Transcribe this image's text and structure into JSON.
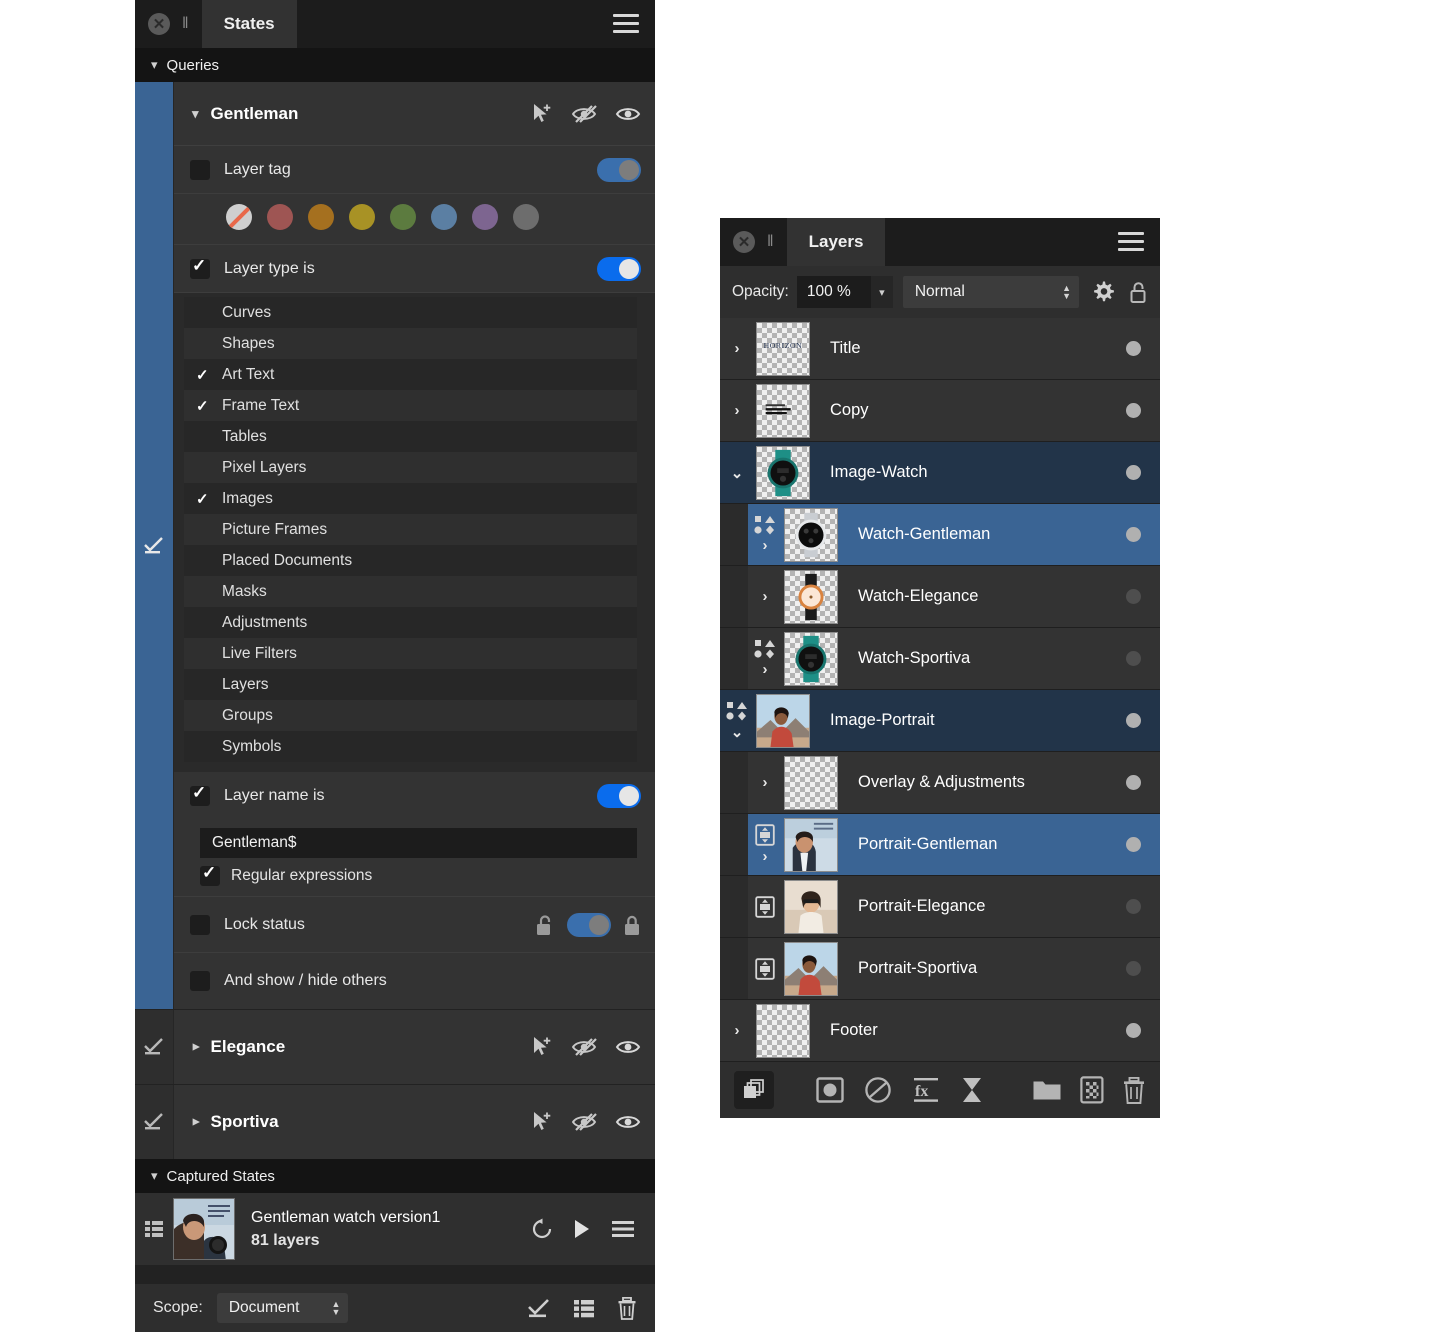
{
  "states_panel": {
    "title": "States",
    "sections": {
      "queries_label": "Queries",
      "captured_label": "Captured States"
    },
    "queries": [
      {
        "name": "Gentleman",
        "expanded": true,
        "conditions": {
          "layer_tag": {
            "label": "Layer tag",
            "checked": false,
            "toggle": "off"
          },
          "layer_type": {
            "label": "Layer type is",
            "checked": true,
            "toggle": "on"
          },
          "layer_name": {
            "label": "Layer name is",
            "checked": true,
            "toggle": "on",
            "value": "Gentleman$",
            "regex_label": "Regular expressions",
            "regex_checked": true
          },
          "lock_status": {
            "label": "Lock status",
            "checked": false,
            "toggle": "mid"
          },
          "show_hide_others": {
            "label": "And show / hide others",
            "checked": false
          }
        },
        "tag_swatches": [
          "none",
          "#9e5553",
          "#a5701f",
          "#a89225",
          "#5c7b3f",
          "#5b7fa3",
          "#7d6590",
          "#6d6d6d"
        ],
        "layer_types": [
          {
            "label": "Curves",
            "checked": false
          },
          {
            "label": "Shapes",
            "checked": false
          },
          {
            "label": "Art Text",
            "checked": true
          },
          {
            "label": "Frame Text",
            "checked": true
          },
          {
            "label": "Tables",
            "checked": false
          },
          {
            "label": "Pixel Layers",
            "checked": false
          },
          {
            "label": "Images",
            "checked": true
          },
          {
            "label": "Picture Frames",
            "checked": false
          },
          {
            "label": "Placed Documents",
            "checked": false
          },
          {
            "label": "Masks",
            "checked": false
          },
          {
            "label": "Adjustments",
            "checked": false
          },
          {
            "label": "Live Filters",
            "checked": false
          },
          {
            "label": "Layers",
            "checked": false
          },
          {
            "label": "Groups",
            "checked": false
          },
          {
            "label": "Symbols",
            "checked": false
          }
        ]
      },
      {
        "name": "Elegance",
        "expanded": false
      },
      {
        "name": "Sportiva",
        "expanded": false
      }
    ],
    "captured_states": [
      {
        "title": "Gentleman watch version1",
        "subtitle": "81 layers"
      }
    ],
    "footer": {
      "scope_label": "Scope:",
      "scope_value": "Document"
    },
    "icons": {
      "select_add": "cursor-plus-icon",
      "hide": "eye-slash-icon",
      "show": "eye-icon",
      "apply": "apply-state-icon",
      "list": "list-icon",
      "delete": "trash-icon",
      "menu": "panel-menu-icon",
      "close": "close-icon",
      "grip": "grip-icon",
      "reset": "reset-icon",
      "play": "play-icon",
      "row_menu": "row-menu-icon"
    }
  },
  "layers_panel": {
    "title": "Layers",
    "options": {
      "opacity_label": "Opacity:",
      "opacity_value": "100 %",
      "blend_mode": "Normal"
    },
    "accent_selected": "#3a6494",
    "accent_parent": "#223449",
    "rows": [
      {
        "name": "Title",
        "depth": 0,
        "state": "plain",
        "toggle": "right",
        "badge": "none",
        "visible": true,
        "thumb": "text-horizon"
      },
      {
        "name": "Copy",
        "depth": 0,
        "state": "plain",
        "toggle": "right",
        "badge": "none",
        "visible": true,
        "thumb": "text-block"
      },
      {
        "name": "Image-Watch",
        "depth": 0,
        "state": "sel-dark",
        "toggle": "down",
        "badge": "none",
        "visible": true,
        "thumb": "watch-sportiva"
      },
      {
        "name": "Watch-Gentleman",
        "depth": 1,
        "state": "sel-light",
        "toggle": "right",
        "badge": "shapes",
        "visible": true,
        "thumb": "watch-gentleman"
      },
      {
        "name": "Watch-Elegance",
        "depth": 1,
        "state": "plain",
        "toggle": "right",
        "badge": "none",
        "visible": false,
        "thumb": "watch-elegance"
      },
      {
        "name": "Watch-Sportiva",
        "depth": 1,
        "state": "plain",
        "toggle": "right",
        "badge": "shapes",
        "visible": false,
        "thumb": "watch-sportiva"
      },
      {
        "name": "Image-Portrait",
        "depth": 0,
        "state": "sel-dark",
        "toggle": "down",
        "badge": "shapes",
        "visible": true,
        "thumb": "portrait-sportiva"
      },
      {
        "name": "Overlay & Adjustments",
        "depth": 1,
        "state": "plain",
        "toggle": "right",
        "badge": "none",
        "visible": true,
        "thumb": "empty"
      },
      {
        "name": "Portrait-Gentleman",
        "depth": 1,
        "state": "sel-light",
        "toggle": "right",
        "badge": "mask",
        "visible": true,
        "thumb": "portrait-gentleman"
      },
      {
        "name": "Portrait-Elegance",
        "depth": 1,
        "state": "plain",
        "toggle": "none",
        "badge": "mask",
        "visible": false,
        "thumb": "portrait-elegance"
      },
      {
        "name": "Portrait-Sportiva",
        "depth": 1,
        "state": "plain",
        "toggle": "none",
        "badge": "mask",
        "visible": false,
        "thumb": "portrait-sportiva"
      },
      {
        "name": "Footer",
        "depth": 0,
        "state": "plain",
        "toggle": "right",
        "badge": "none",
        "visible": true,
        "thumb": "empty"
      }
    ],
    "icons": {
      "gear": "gear-icon",
      "lock": "lock-icon",
      "close": "close-icon",
      "grip": "grip-icon",
      "menu": "panel-menu-icon",
      "duplicate": "duplicate-layer-icon",
      "mask": "mask-icon",
      "adjustment": "adjustment-icon",
      "fx": "live-filter-icon",
      "effects": "effects-icon",
      "group": "group-icon",
      "new_pixel": "new-pixel-layer-icon",
      "delete": "trash-icon"
    }
  }
}
